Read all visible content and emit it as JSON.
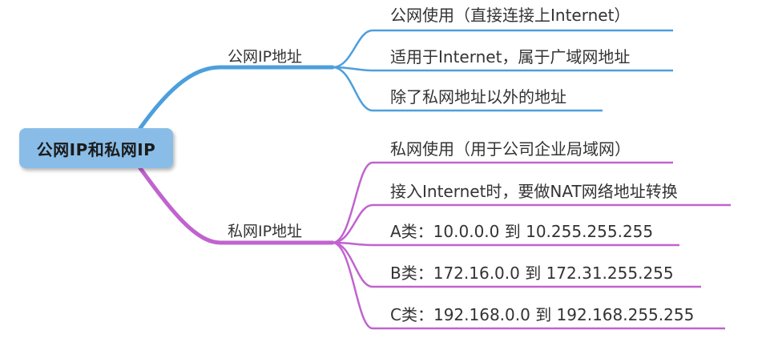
{
  "root": {
    "label": "公网IP和私网IP"
  },
  "branches": [
    {
      "label": "公网IP地址",
      "color": "#4d9fdc",
      "leaves": [
        "公网使用（直接连接上Internet）",
        "适用于Internet，属于广域网地址",
        "除了私网地址以外的地址"
      ]
    },
    {
      "label": "私网IP地址",
      "color": "#c163cf",
      "leaves": [
        "私网使用（用于公司企业局域网）",
        "接入Internet时，要做NAT网络地址转换",
        "A类：10.0.0.0 到 10.255.255.255",
        "B类：172.16.0.0 到 172.31.255.255",
        "C类：192.168.0.0 到 192.168.255.255"
      ]
    }
  ]
}
